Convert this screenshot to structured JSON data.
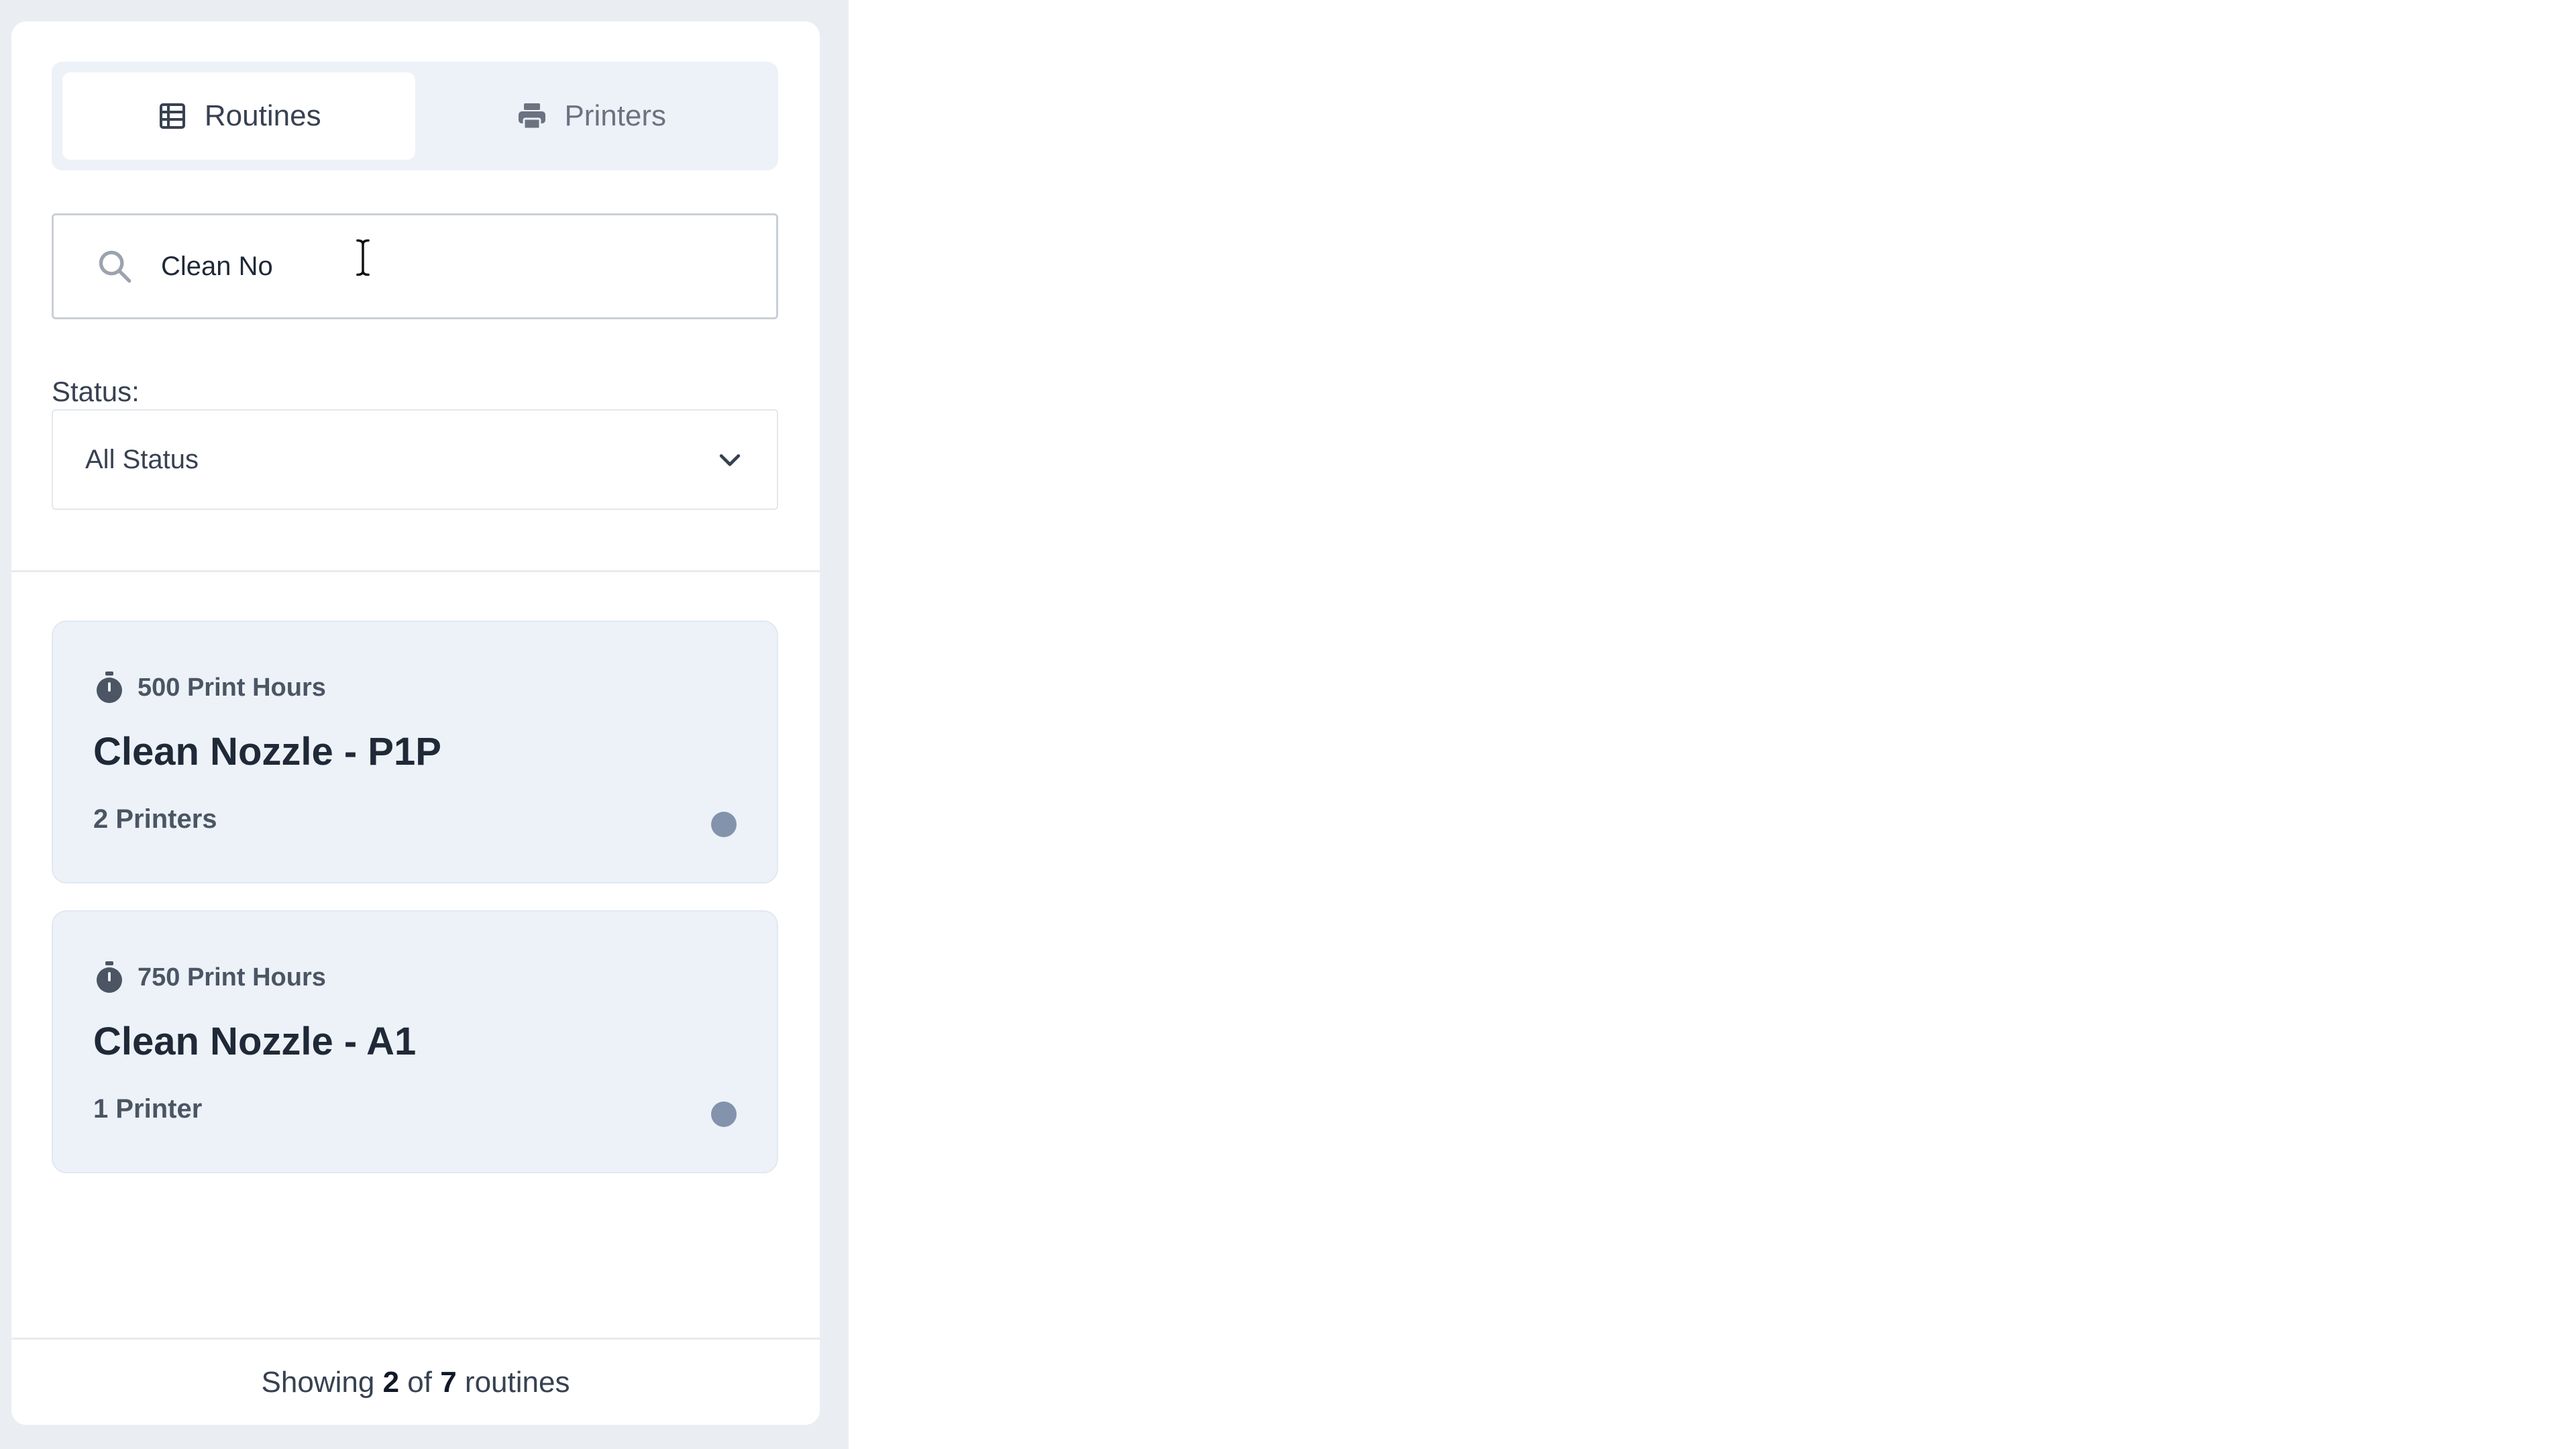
{
  "tabs": [
    {
      "label": "Routines",
      "icon": "table-list-icon",
      "active": true
    },
    {
      "label": "Printers",
      "icon": "printer-icon",
      "active": false
    }
  ],
  "search": {
    "value": "Clean No",
    "icon": "search-icon"
  },
  "filter": {
    "label": "Status:",
    "selected": "All Status",
    "icon": "chevron-down-icon"
  },
  "routines": [
    {
      "interval": "500 Print Hours",
      "title": "Clean Nozzle - P1P",
      "printers": "2 Printers",
      "status_color": "#8393ab"
    },
    {
      "interval": "750 Print Hours",
      "title": "Clean Nozzle - A1",
      "printers": "1 Printer",
      "status_color": "#8393ab"
    }
  ],
  "footer": {
    "prefix": "Showing ",
    "shown": "2",
    "middle": " of ",
    "total": "7",
    "suffix": " routines"
  },
  "colors": {
    "card_bg": "#edf2f8",
    "backdrop": "#eaeef2",
    "status_dot": "#8393ab"
  }
}
